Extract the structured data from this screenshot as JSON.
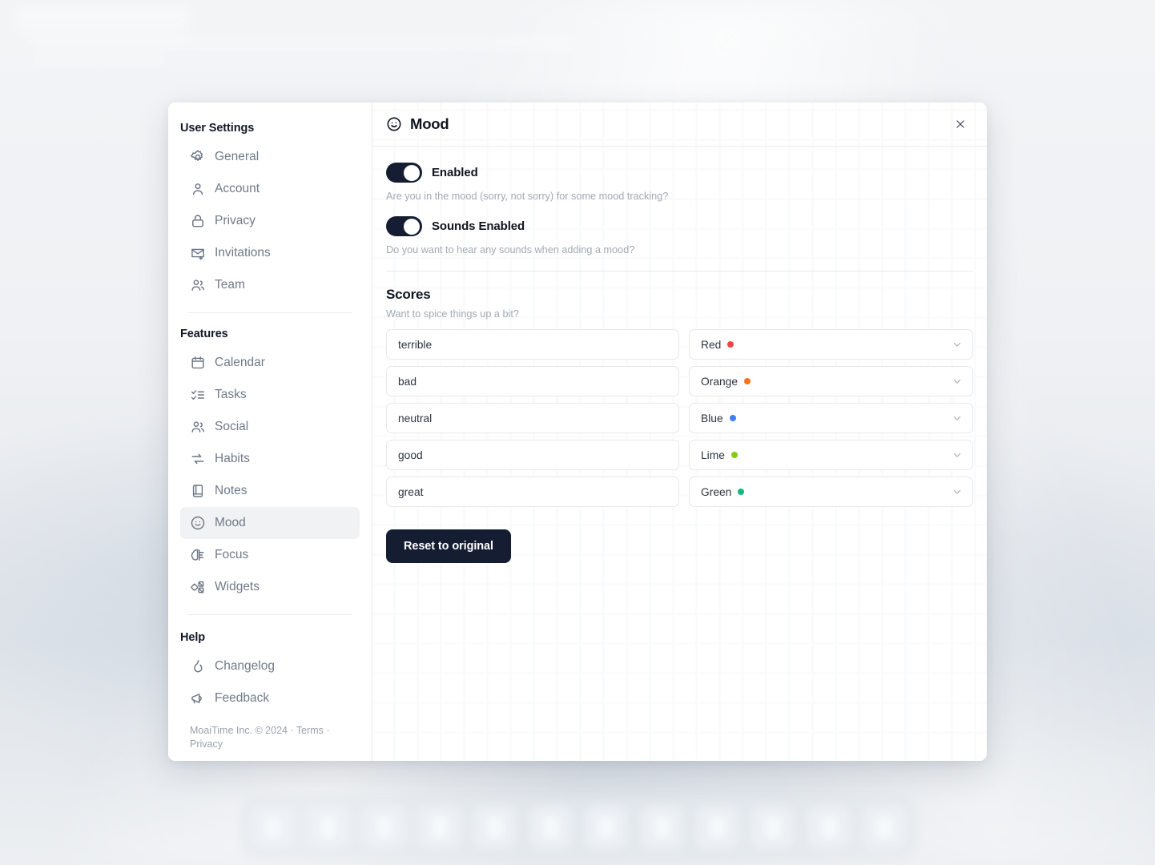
{
  "sidebar": {
    "groups": [
      {
        "heading": "User Settings",
        "items": [
          {
            "label": "General",
            "icon": "gear-icon"
          },
          {
            "label": "Account",
            "icon": "user-icon"
          },
          {
            "label": "Privacy",
            "icon": "lock-icon"
          },
          {
            "label": "Invitations",
            "icon": "mail-plus-icon"
          },
          {
            "label": "Team",
            "icon": "users-icon"
          }
        ]
      },
      {
        "heading": "Features",
        "items": [
          {
            "label": "Calendar",
            "icon": "calendar-icon"
          },
          {
            "label": "Tasks",
            "icon": "check-list-icon"
          },
          {
            "label": "Social",
            "icon": "users-icon"
          },
          {
            "label": "Habits",
            "icon": "repeat-icon"
          },
          {
            "label": "Notes",
            "icon": "notebook-icon"
          },
          {
            "label": "Mood",
            "icon": "smiley-icon"
          },
          {
            "label": "Focus",
            "icon": "brain-icon"
          },
          {
            "label": "Widgets",
            "icon": "widgets-icon"
          }
        ]
      },
      {
        "heading": "Help",
        "items": [
          {
            "label": "Changelog",
            "icon": "flame-icon"
          },
          {
            "label": "Feedback",
            "icon": "megaphone-icon"
          }
        ]
      }
    ],
    "active_item": "Mood",
    "footer": "MoaiTime Inc. © 2024 · Terms · Privacy"
  },
  "panel": {
    "title": "Mood",
    "title_icon": "smiley-icon",
    "close_icon": "close-icon",
    "toggles": [
      {
        "label": "Enabled",
        "state": "on",
        "help": "Are you in the mood (sorry, not sorry) for some mood tracking?"
      },
      {
        "label": "Sounds Enabled",
        "state": "on",
        "help": "Do you want to hear any sounds when adding a mood?"
      }
    ],
    "scores_section": {
      "title": "Scores",
      "subtitle": "Want to spice things up a bit?",
      "rows": [
        {
          "value": "terrible",
          "color_label": "Red",
          "color_hex": "#ef4444"
        },
        {
          "value": "bad",
          "color_label": "Orange",
          "color_hex": "#f97316"
        },
        {
          "value": "neutral",
          "color_label": "Blue",
          "color_hex": "#3b82f6"
        },
        {
          "value": "good",
          "color_label": "Lime",
          "color_hex": "#84cc16"
        },
        {
          "value": "great",
          "color_label": "Green",
          "color_hex": "#10b981"
        }
      ]
    },
    "reset_label": "Reset to original"
  }
}
